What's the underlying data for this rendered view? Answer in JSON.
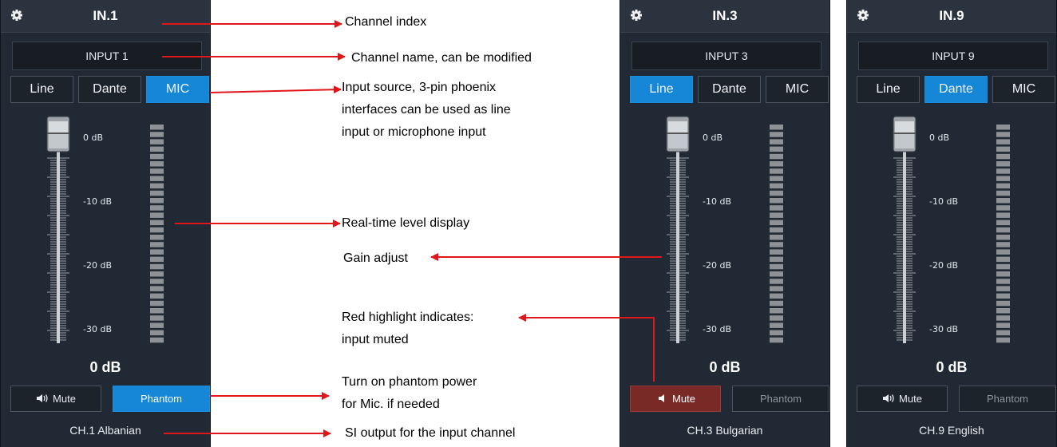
{
  "colors": {
    "accent": "#1587d6",
    "muted_red": "#7a2a26",
    "annotation_arrow": "#e0161b"
  },
  "channels": [
    {
      "title": "IN.1",
      "name": "INPUT 1",
      "sources": [
        "Line",
        "Dante",
        "MIC"
      ],
      "active_source": "MIC",
      "ticks": [
        "0 dB",
        "-10 dB",
        "-20 dB",
        "-30 dB"
      ],
      "gain_db": "0 dB",
      "mute_label": "Mute",
      "phantom_label": "Phantom",
      "muted": false,
      "phantom_on": true,
      "output": "CH.1 Albanian"
    },
    {
      "title": "IN.3",
      "name": "INPUT 3",
      "sources": [
        "Line",
        "Dante",
        "MIC"
      ],
      "active_source": "Line",
      "ticks": [
        "0 dB",
        "-10 dB",
        "-20 dB",
        "-30 dB"
      ],
      "gain_db": "0 dB",
      "mute_label": "Mute",
      "phantom_label": "Phantom",
      "muted": true,
      "phantom_on": false,
      "output": "CH.3 Bulgarian"
    },
    {
      "title": "IN.9",
      "name": "INPUT 9",
      "sources": [
        "Line",
        "Dante",
        "MIC"
      ],
      "active_source": "Dante",
      "ticks": [
        "0 dB",
        "-10 dB",
        "-20 dB",
        "-30 dB"
      ],
      "gain_db": "0 dB",
      "mute_label": "Mute",
      "phantom_label": "Phantom",
      "muted": false,
      "phantom_on": false,
      "output": "CH.9 English"
    }
  ],
  "annotations": {
    "channel_index": "Channel index",
    "channel_name": "Channel name, can be modified",
    "input_source": [
      "Input source, 3-pin phoenix",
      "interfaces can be used as line",
      "input or microphone input"
    ],
    "level_display": "Real-time level display",
    "gain_adjust": "Gain adjust",
    "mute_note": [
      "Red highlight indicates:",
      "input muted"
    ],
    "phantom_note": [
      "Turn on phantom power",
      "for Mic. if needed"
    ],
    "si_output": "SI output for the input channel"
  }
}
